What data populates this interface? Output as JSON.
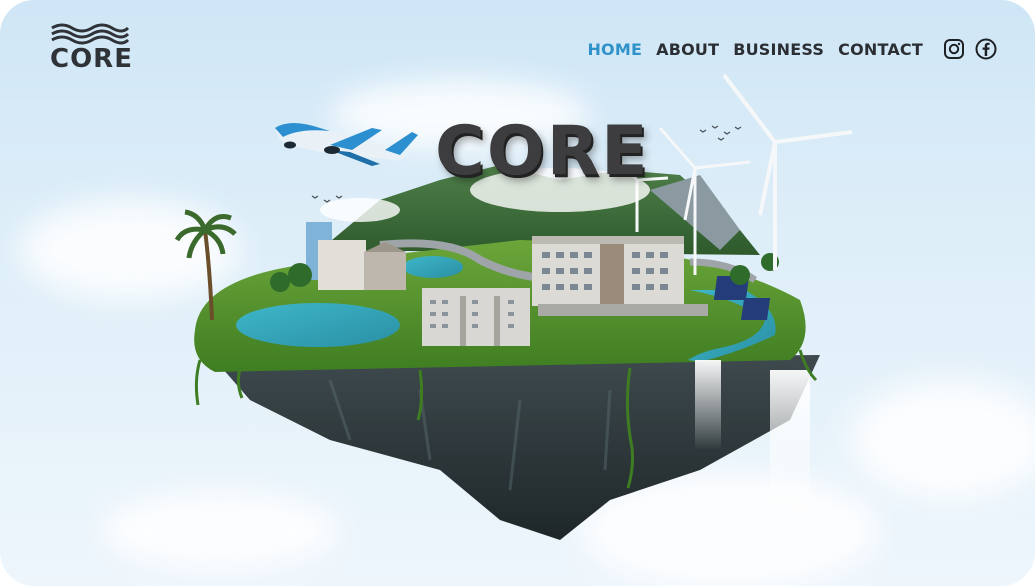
{
  "brand": {
    "logo_text": "CORE",
    "logo_icon": "wave-lines-icon"
  },
  "nav": {
    "items": [
      {
        "label": "HOME",
        "active": true
      },
      {
        "label": "ABOUT",
        "active": false
      },
      {
        "label": "BUSINESS",
        "active": false
      },
      {
        "label": "CONTACT",
        "active": false
      }
    ],
    "social": [
      "instagram-icon",
      "facebook-icon"
    ]
  },
  "hero": {
    "title": "CORE"
  },
  "colors": {
    "accent": "#2f93c9",
    "nav_text": "#2b2f33",
    "sky": "#d6eaf7"
  }
}
